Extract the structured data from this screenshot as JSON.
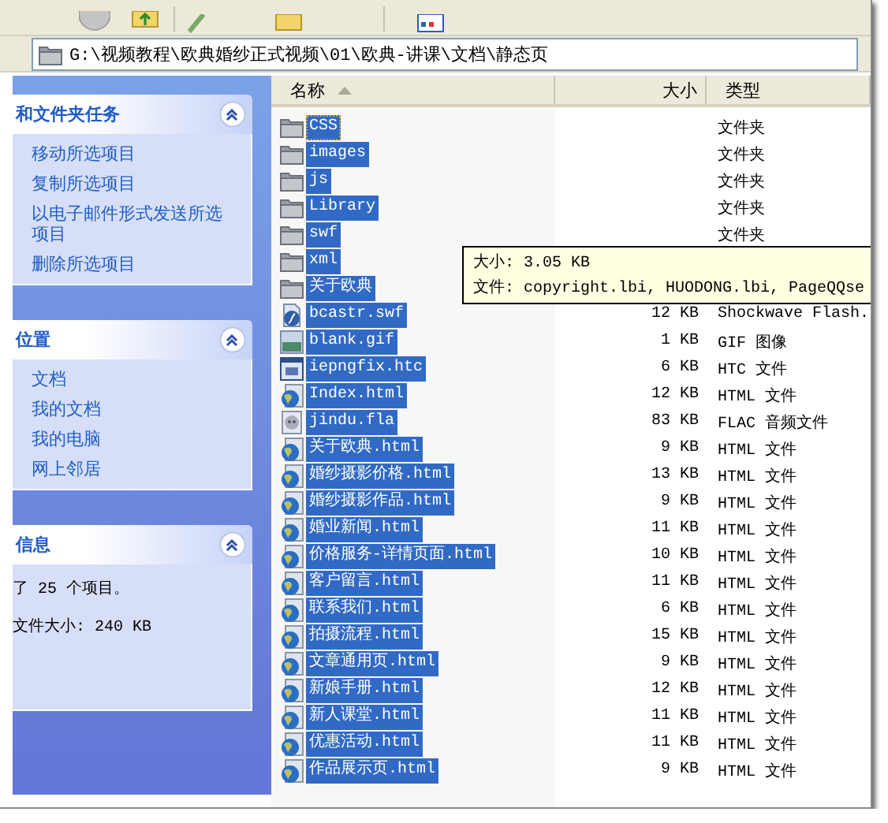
{
  "address_bar": {
    "path": "G:\\视频教程\\欧典婚纱正式视频\\01\\欧典-讲课\\文档\\静态页"
  },
  "task_panels": [
    {
      "title": "和文件夹任务",
      "expanded": true,
      "links": [
        "移动所选项目",
        "复制所选项目",
        "以电子邮件形式发送所选项目",
        "删除所选项目"
      ]
    },
    {
      "title": "位置",
      "expanded": true,
      "links": [
        "文档",
        "我的文档",
        "我的电脑",
        "网上邻居"
      ]
    }
  ],
  "details_panel": {
    "title": "信息",
    "expanded": true,
    "lines": [
      "了 25 个项目。",
      "文件大小: 240 KB"
    ]
  },
  "file_list": {
    "columns": [
      {
        "label": "名称",
        "sorted": true
      },
      {
        "label": "大小",
        "sorted": false
      },
      {
        "label": "类型",
        "sorted": false
      }
    ],
    "rows": [
      {
        "name": "CSS",
        "kind": "folder",
        "type": "文件夹",
        "selected": true,
        "focused": true
      },
      {
        "name": "images",
        "kind": "folder",
        "type": "文件夹",
        "selected": true,
        "focused": false
      },
      {
        "name": "js",
        "kind": "folder",
        "type": "文件夹",
        "selected": true,
        "focused": false
      },
      {
        "name": "Library",
        "kind": "folder",
        "type": "文件夹",
        "selected": true,
        "focused": false
      },
      {
        "name": "swf",
        "kind": "folder",
        "type": "文件夹",
        "selected": true,
        "focused": false
      },
      {
        "name": "xml",
        "kind": "folder",
        "selected": true,
        "focused": false
      },
      {
        "name": "关于欧典",
        "kind": "folder",
        "selected": true,
        "focused": false
      },
      {
        "name": "bcastr.swf",
        "kind": "flash",
        "size": "12 KB",
        "type": "Shockwave Flash.",
        "selected": true,
        "focused": false
      },
      {
        "name": "blank.gif",
        "kind": "image",
        "size": "1 KB",
        "type": "GIF 图像",
        "selected": true,
        "focused": false
      },
      {
        "name": "iepngfix.htc",
        "kind": "script",
        "size": "6 KB",
        "type": "HTC 文件",
        "selected": true,
        "focused": false
      },
      {
        "name": "Index.html",
        "kind": "web",
        "size": "12 KB",
        "type": "HTML 文件",
        "selected": true,
        "focused": false
      },
      {
        "name": "jindu.fla",
        "kind": "audio",
        "size": "83 KB",
        "type": "FLAC 音频文件",
        "selected": true,
        "focused": false
      },
      {
        "name": "关于欧典.html",
        "kind": "web",
        "size": "9 KB",
        "type": "HTML 文件",
        "selected": true,
        "focused": false
      },
      {
        "name": "婚纱摄影价格.html",
        "kind": "web",
        "size": "13 KB",
        "type": "HTML 文件",
        "selected": true,
        "focused": false
      },
      {
        "name": "婚纱摄影作品.html",
        "kind": "web",
        "size": "9 KB",
        "type": "HTML 文件",
        "selected": true,
        "focused": false
      },
      {
        "name": "婚业新闻.html",
        "kind": "web",
        "size": "11 KB",
        "type": "HTML 文件",
        "selected": true,
        "focused": false
      },
      {
        "name": "价格服务-详情页面.html",
        "kind": "web",
        "size": "10 KB",
        "type": "HTML 文件",
        "selected": true,
        "focused": false
      },
      {
        "name": "客户留言.html",
        "kind": "web",
        "size": "11 KB",
        "type": "HTML 文件",
        "selected": true,
        "focused": false
      },
      {
        "name": "联系我们.html",
        "kind": "web",
        "size": "6 KB",
        "type": "HTML 文件",
        "selected": true,
        "focused": false
      },
      {
        "name": "拍摄流程.html",
        "kind": "web",
        "size": "15 KB",
        "type": "HTML 文件",
        "selected": true,
        "focused": false
      },
      {
        "name": "文章通用页.html",
        "kind": "web",
        "size": "9 KB",
        "type": "HTML 文件",
        "selected": true,
        "focused": false
      },
      {
        "name": "新娘手册.html",
        "kind": "web",
        "size": "12 KB",
        "type": "HTML 文件",
        "selected": true,
        "focused": false
      },
      {
        "name": "新人课堂.html",
        "kind": "web",
        "size": "11 KB",
        "type": "HTML 文件",
        "selected": true,
        "focused": false
      },
      {
        "name": "优惠活动.html",
        "kind": "web",
        "size": "11 KB",
        "type": "HTML 文件",
        "selected": true,
        "focused": false
      },
      {
        "name": "作品展示页.html",
        "kind": "web",
        "size": "9 KB",
        "type": "HTML 文件",
        "selected": true,
        "focused": false
      }
    ]
  },
  "tooltip": {
    "lines": [
      "大小: 3.05 KB",
      "文件: copyright.lbi, HUODONG.lbi, PageQQse"
    ]
  }
}
